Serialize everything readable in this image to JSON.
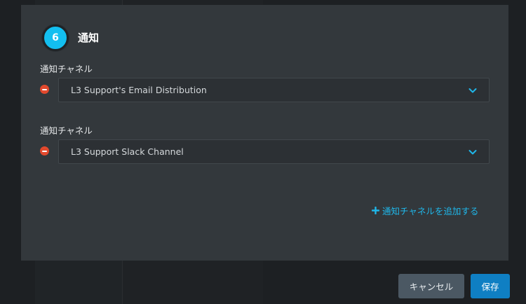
{
  "section": {
    "step_number": "6",
    "title": "通知"
  },
  "channels": [
    {
      "label": "通知チャネル",
      "value": "L3 Support's Email Distribution"
    },
    {
      "label": "通知チャネル",
      "value": "L3 Support Slack Channel"
    }
  ],
  "add_channel_label": "通知チャネルを追加する",
  "buttons": {
    "cancel_label": "キャンセル",
    "save_label": "保存"
  },
  "colors": {
    "accent": "#13bff0",
    "link": "#1fb7ea",
    "remove": "#e2492d",
    "primary_button": "#0f7fc3",
    "secondary_button": "#4b5863",
    "modal_bg": "#33383c"
  },
  "icons": {
    "remove": "minus-circle-icon",
    "dropdown": "chevron-down-icon",
    "add": "plus-icon"
  }
}
